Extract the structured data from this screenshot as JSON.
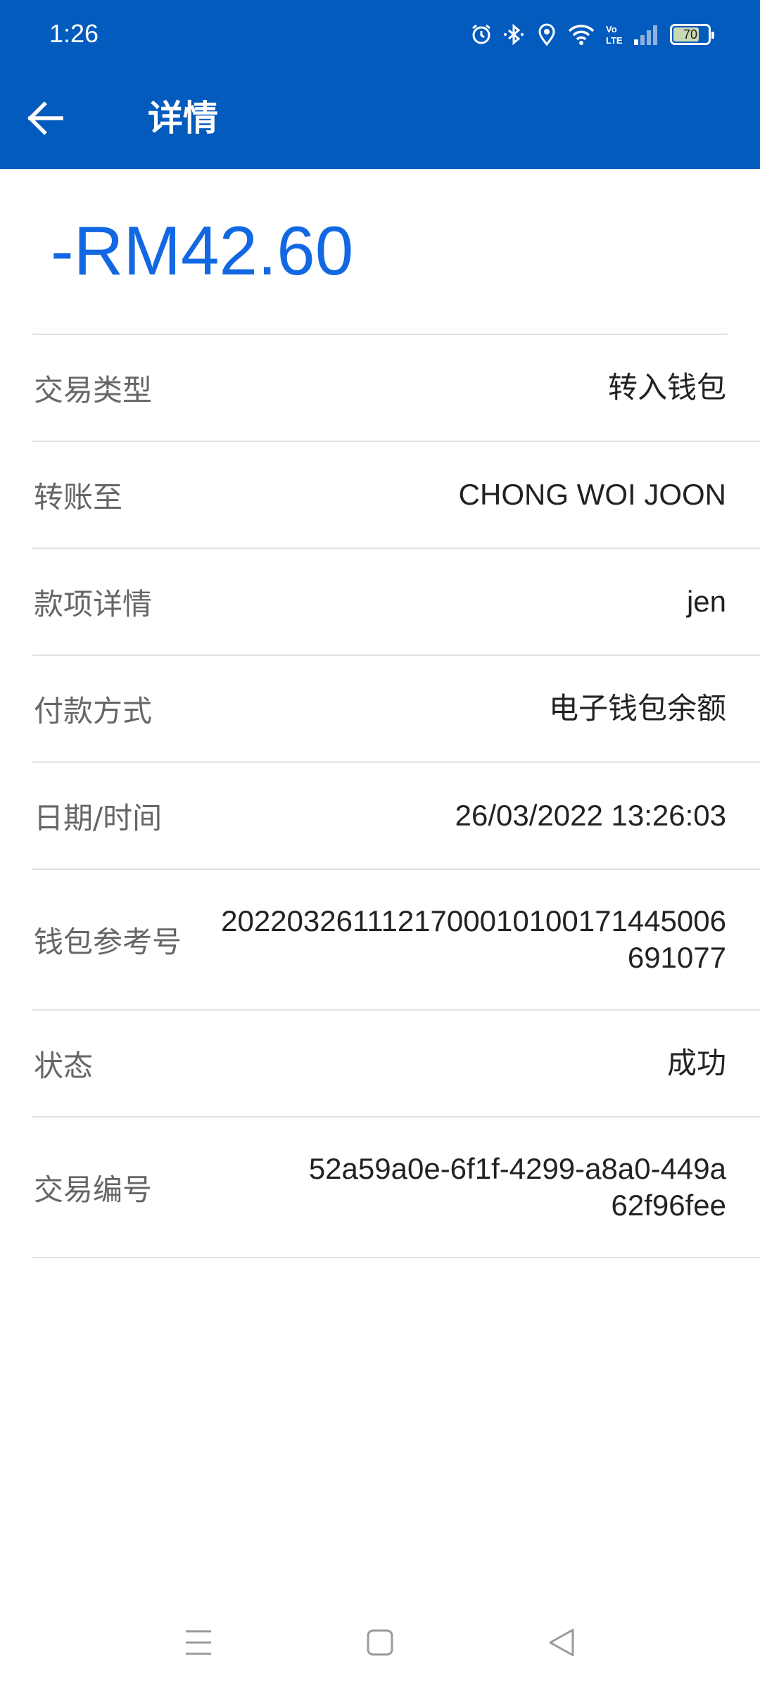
{
  "status_bar": {
    "time": "1:26",
    "icons": [
      "alarm-icon",
      "bluetooth-icon",
      "location-icon",
      "wifi-icon",
      "volte-icon",
      "signal-icon",
      "battery-icon"
    ],
    "battery_level": "70"
  },
  "app_bar": {
    "title": "详情",
    "back_icon": "arrow-left-icon",
    "color": "#025bbd"
  },
  "amount": {
    "text": "-RM42.60",
    "color": "#1268e2"
  },
  "details": [
    {
      "label": "交易类型",
      "value": "转入钱包"
    },
    {
      "label": "转账至",
      "value": "CHONG WOI JOON"
    },
    {
      "label": "款项详情",
      "value": "jen"
    },
    {
      "label": "付款方式",
      "value": "电子钱包余额"
    },
    {
      "label": "日期/时间",
      "value": "26/03/2022 13:26:03"
    },
    {
      "label": "钱包参考号",
      "value": "2022032611121700010100171445006691077"
    },
    {
      "label": "状态",
      "value": "成功"
    },
    {
      "label": "交易编号",
      "value": "52a59a0e-6f1f-4299-a8a0-449a62f96fee"
    }
  ],
  "nav_bar": {
    "buttons": [
      "menu-icon",
      "home-icon",
      "back-triangle-icon"
    ]
  }
}
